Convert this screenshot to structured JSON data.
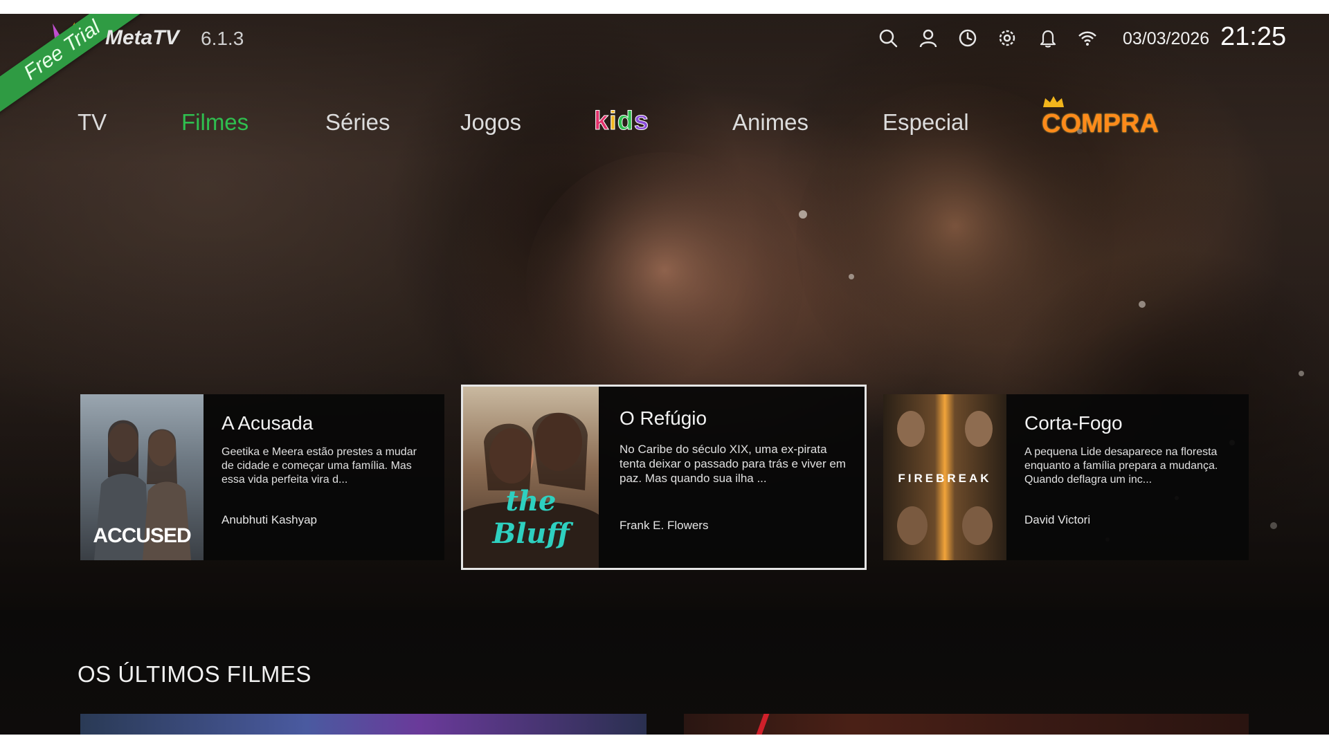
{
  "header": {
    "badge": "Free Trial",
    "app_name": "MetaTV",
    "version": "6.1.3",
    "date": "03/03/2026",
    "time": "21:25",
    "icons": [
      "search-icon",
      "user-icon",
      "history-icon",
      "settings-icon",
      "bell-icon",
      "wifi-icon"
    ]
  },
  "nav": {
    "items": [
      {
        "label": "TV",
        "active": false
      },
      {
        "label": "Filmes",
        "active": true
      },
      {
        "label": "Séries",
        "active": false
      },
      {
        "label": "Jogos",
        "active": false
      },
      {
        "label": "kids",
        "active": false
      },
      {
        "label": "Animes",
        "active": false
      },
      {
        "label": "Especial",
        "active": false
      },
      {
        "label": "COMPRA",
        "active": false
      }
    ]
  },
  "featured": [
    {
      "poster_text": "ACCUSED",
      "title": "A Acusada",
      "description": "Geetika e Meera estão prestes a mudar de cidade e começar uma família. Mas essa vida perfeita vira d...",
      "director": "Anubhuti Kashyap",
      "focused": false
    },
    {
      "poster_text": "the Bluff",
      "title": "O Refúgio",
      "description": "No Caribe do século XIX, uma ex-pirata tenta deixar o passado para trás e viver em paz. Mas quando sua ilha ...",
      "director": "Frank E. Flowers",
      "focused": true
    },
    {
      "poster_text": "FIREBREAK",
      "title": "Corta-Fogo",
      "description": "A pequena Lide desaparece na floresta enquanto a família prepara a mudança. Quando deflagra um inc...",
      "director": "David Victori",
      "focused": false
    }
  ],
  "section": {
    "title": "OS ÚLTIMOS FILMES"
  },
  "colors": {
    "accent_green": "#2fbf4f",
    "ribbon_green": "#2f9b43",
    "compra_orange": "#ff8a1a",
    "kids_letters": [
      "#e0306a",
      "#f2b51c",
      "#2fbf4f",
      "#8a4dd8"
    ]
  }
}
